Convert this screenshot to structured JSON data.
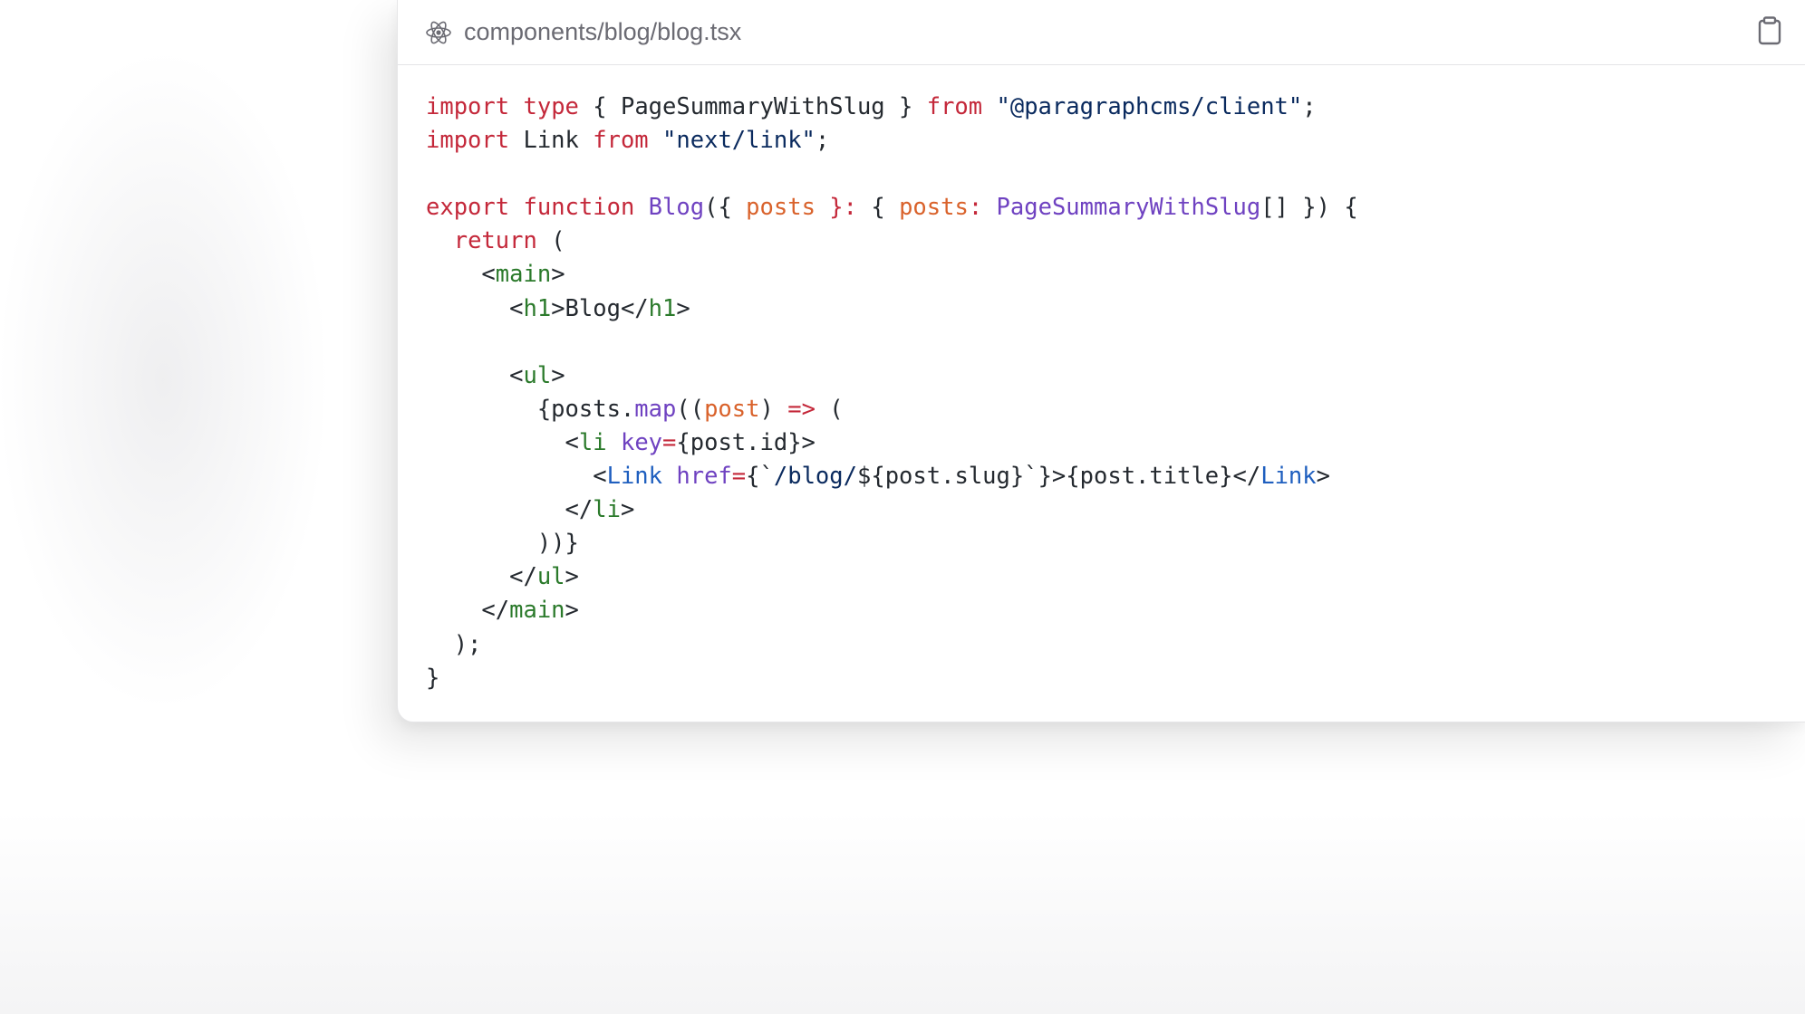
{
  "file": {
    "name": "components/blog/blog.tsx",
    "language_icon": "react-icon",
    "copy_icon": "clipboard-icon"
  },
  "colors": {
    "keyword": "#c4283a",
    "string": "#0a2a5e",
    "function": "#6f42c1",
    "parameter": "#d9622b",
    "tag": "#2b7a2b",
    "component": "#1f5fbf",
    "text": "#24292f"
  },
  "code": {
    "lines": [
      [
        {
          "t": "kw",
          "v": "import"
        },
        {
          "t": "plain",
          "v": " "
        },
        {
          "t": "kw",
          "v": "type"
        },
        {
          "t": "plain",
          "v": " { PageSummaryWithSlug } "
        },
        {
          "t": "kw",
          "v": "from"
        },
        {
          "t": "plain",
          "v": " "
        },
        {
          "t": "str",
          "v": "\"@paragraphcms/client\""
        },
        {
          "t": "plain",
          "v": ";"
        }
      ],
      [
        {
          "t": "kw",
          "v": "import"
        },
        {
          "t": "plain",
          "v": " Link "
        },
        {
          "t": "kw",
          "v": "from"
        },
        {
          "t": "plain",
          "v": " "
        },
        {
          "t": "str",
          "v": "\"next/link\""
        },
        {
          "t": "plain",
          "v": ";"
        }
      ],
      [],
      [
        {
          "t": "kw",
          "v": "export"
        },
        {
          "t": "plain",
          "v": " "
        },
        {
          "t": "kw",
          "v": "function"
        },
        {
          "t": "plain",
          "v": " "
        },
        {
          "t": "fn",
          "v": "Blog"
        },
        {
          "t": "plain",
          "v": "({ "
        },
        {
          "t": "param",
          "v": "posts"
        },
        {
          "t": "plain",
          "v": " "
        },
        {
          "t": "kw",
          "v": "}:"
        },
        {
          "t": "plain",
          "v": " { "
        },
        {
          "t": "param",
          "v": "posts"
        },
        {
          "t": "kw",
          "v": ":"
        },
        {
          "t": "plain",
          "v": " "
        },
        {
          "t": "fn",
          "v": "PageSummaryWithSlug"
        },
        {
          "t": "plain",
          "v": "[] }) {"
        }
      ],
      [
        {
          "t": "plain",
          "v": "  "
        },
        {
          "t": "kw",
          "v": "return"
        },
        {
          "t": "plain",
          "v": " ("
        }
      ],
      [
        {
          "t": "plain",
          "v": "    <"
        },
        {
          "t": "tag",
          "v": "main"
        },
        {
          "t": "plain",
          "v": ">"
        }
      ],
      [
        {
          "t": "plain",
          "v": "      <"
        },
        {
          "t": "tag",
          "v": "h1"
        },
        {
          "t": "plain",
          "v": ">Blog</"
        },
        {
          "t": "tag",
          "v": "h1"
        },
        {
          "t": "plain",
          "v": ">"
        }
      ],
      [],
      [
        {
          "t": "plain",
          "v": "      <"
        },
        {
          "t": "tag",
          "v": "ul"
        },
        {
          "t": "plain",
          "v": ">"
        }
      ],
      [
        {
          "t": "plain",
          "v": "        {posts."
        },
        {
          "t": "fn",
          "v": "map"
        },
        {
          "t": "plain",
          "v": "(("
        },
        {
          "t": "param",
          "v": "post"
        },
        {
          "t": "plain",
          "v": ") "
        },
        {
          "t": "kw",
          "v": "=>"
        },
        {
          "t": "plain",
          "v": " ("
        }
      ],
      [
        {
          "t": "plain",
          "v": "          <"
        },
        {
          "t": "tag",
          "v": "li"
        },
        {
          "t": "plain",
          "v": " "
        },
        {
          "t": "attr",
          "v": "key"
        },
        {
          "t": "kw",
          "v": "="
        },
        {
          "t": "plain",
          "v": "{post.id}>"
        }
      ],
      [
        {
          "t": "plain",
          "v": "            <"
        },
        {
          "t": "comp",
          "v": "Link"
        },
        {
          "t": "plain",
          "v": " "
        },
        {
          "t": "attr",
          "v": "href"
        },
        {
          "t": "kw",
          "v": "="
        },
        {
          "t": "plain",
          "v": "{`"
        },
        {
          "t": "str",
          "v": "/blog/"
        },
        {
          "t": "plain",
          "v": "${post.slug}`}>{post.title}</"
        },
        {
          "t": "comp",
          "v": "Link"
        },
        {
          "t": "plain",
          "v": ">"
        }
      ],
      [
        {
          "t": "plain",
          "v": "          </"
        },
        {
          "t": "tag",
          "v": "li"
        },
        {
          "t": "plain",
          "v": ">"
        }
      ],
      [
        {
          "t": "plain",
          "v": "        ))}"
        }
      ],
      [
        {
          "t": "plain",
          "v": "      </"
        },
        {
          "t": "tag",
          "v": "ul"
        },
        {
          "t": "plain",
          "v": ">"
        }
      ],
      [
        {
          "t": "plain",
          "v": "    </"
        },
        {
          "t": "tag",
          "v": "main"
        },
        {
          "t": "plain",
          "v": ">"
        }
      ],
      [
        {
          "t": "plain",
          "v": "  );"
        }
      ],
      [
        {
          "t": "plain",
          "v": "}"
        }
      ]
    ]
  }
}
